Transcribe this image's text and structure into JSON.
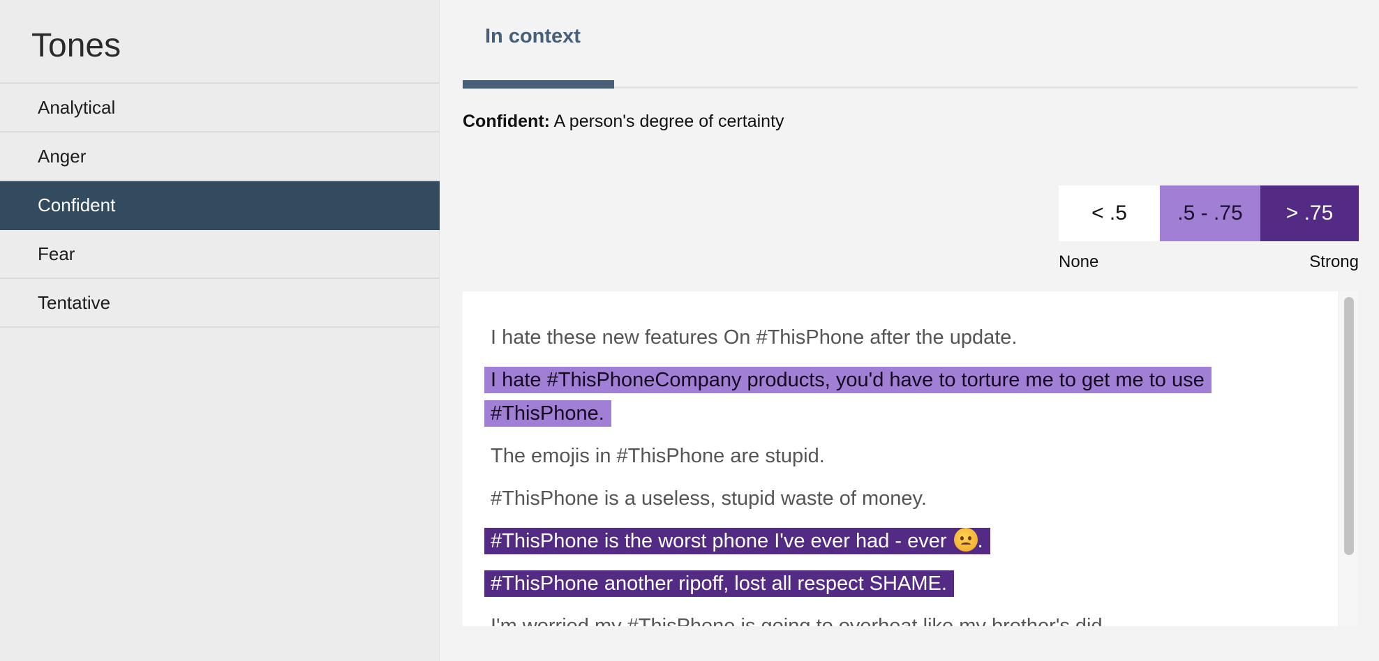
{
  "sidebar": {
    "title": "Tones",
    "items": [
      {
        "label": "Analytical",
        "active": false
      },
      {
        "label": "Anger",
        "active": false
      },
      {
        "label": "Confident",
        "active": true
      },
      {
        "label": "Fear",
        "active": false
      },
      {
        "label": "Tentative",
        "active": false
      }
    ]
  },
  "main": {
    "tab": {
      "label": "In context",
      "selected": true
    },
    "definition": {
      "term": "Confident:",
      "text": "A person's degree of certainty"
    },
    "legend": {
      "ranges": [
        {
          "label": "< .5",
          "color": "#ffffff"
        },
        {
          "label": ".5 - .75",
          "color": "#a07fd5"
        },
        {
          "label": "> .75",
          "color": "#532b85"
        }
      ],
      "min_caption": "None",
      "max_caption": "Strong"
    },
    "sentences": [
      {
        "text": "I hate these new features On #ThisPhone after the update.",
        "level": "none"
      },
      {
        "text": "I hate #ThisPhoneCompany products, you'd have to torture me to get me to use #ThisPhone.",
        "level": "mid"
      },
      {
        "text": "The emojis in #ThisPhone are stupid.",
        "level": "none"
      },
      {
        "text": "#ThisPhone is a useless, stupid waste of money.",
        "level": "none"
      },
      {
        "text": "#ThisPhone is the worst phone I've ever had - ever",
        "suffix": ".",
        "emoji": "angry-face-emoji",
        "level": "high"
      },
      {
        "text": "#ThisPhone another ripoff, lost all respect SHAME.",
        "level": "high"
      },
      {
        "text": "I'm worried my #ThisPhone is going to overheat like my brother's did.",
        "level": "none"
      }
    ]
  },
  "colors": {
    "sidebar_active": "#324b5e",
    "tab_accent": "#46607a",
    "mid_highlight": "#a07fd5",
    "high_highlight": "#532b85"
  }
}
